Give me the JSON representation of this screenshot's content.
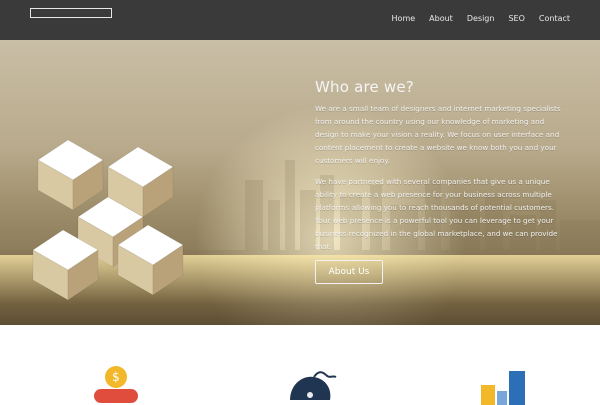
{
  "header": {
    "nav": [
      {
        "label": "Home"
      },
      {
        "label": "About"
      },
      {
        "label": "Design"
      },
      {
        "label": "SEO"
      },
      {
        "label": "Contact"
      }
    ]
  },
  "hero": {
    "title": "Who are we?",
    "paragraphs": [
      "We are a small team of designers and internet marketing specialists from around the country using our knowledge of marketing and design to make your vision a reality. We focus on user interface and content placement to create a website we know both you and your customers will enjoy.",
      "We have partnered with several companies that give us a unique ability to create a web presence for your business across multiple platforms allowing you to reach thousands of potential customers. Your web presence is a powerful tool you can leverage to get your business recognized in the global marketplace, and we can provide that."
    ],
    "button_label": "About Us"
  },
  "icons": {
    "logo": "logo-outline",
    "cubes": "cube-logo-icon",
    "services": [
      "piggy-bank-coin-icon",
      "computer-mouse-icon",
      "bar-chart-icon"
    ]
  },
  "colors": {
    "topbar": "#3a3a3a",
    "cube_light": "#ffffff",
    "cube_tan": "#d9c9a3",
    "cube_shadow": "#b9a27a",
    "coin": "#f3b82a",
    "pig": "#e04d3d",
    "mouse": "#1f3552",
    "chart_yellow": "#f3b82a",
    "chart_blue": "#2c6fb6"
  }
}
